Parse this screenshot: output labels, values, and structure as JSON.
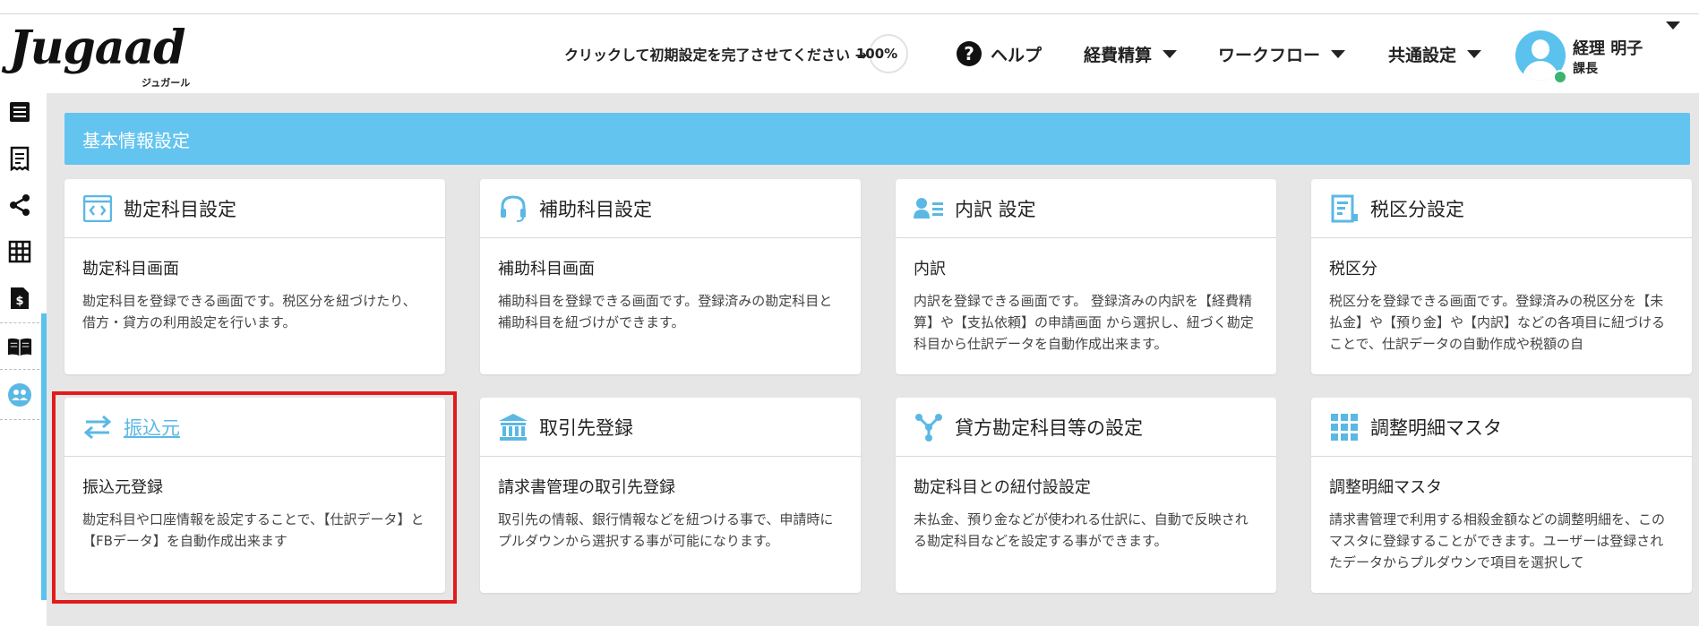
{
  "header": {
    "logo_text": "Jugaad",
    "logo_sub": "ジュガール",
    "setup_text": "クリックして初期設定を完了させてください →",
    "setup_progress": "100%",
    "help_label": "ヘルプ",
    "nav": [
      {
        "label": "経費精算"
      },
      {
        "label": "ワークフロー"
      },
      {
        "label": "共通設定"
      }
    ],
    "user": {
      "name": "経理 明子",
      "role": "課長"
    }
  },
  "sidebar": {
    "icons": [
      "list-icon",
      "receipt-icon",
      "share-icon",
      "grid-icon",
      "invoice-icon",
      "manual-book-icon",
      "support-icon"
    ]
  },
  "section": {
    "title": "基本情報設定"
  },
  "cards": [
    {
      "title": "勘定科目設定",
      "icon": "code-window-icon",
      "subtitle": "勘定科目画面",
      "desc": "勘定科目を登録できる画面です。税区分を紐づけたり、借方・貸方の利用設定を行います。"
    },
    {
      "title": "補助科目設定",
      "icon": "headset-icon",
      "subtitle": "補助科目画面",
      "desc": "補助科目を登録できる画面です。登録済みの勘定科目と補助科目を紐づけができます。"
    },
    {
      "title": "内訳 設定",
      "icon": "user-list-icon",
      "subtitle": "内訳",
      "desc": "内訳を登録できる画面です。 登録済みの内訳を【経費精算】や【支払依頼】の申請画面 から選択し、紐づく勘定科目から仕訳データを自動作成出来ます。"
    },
    {
      "title": "税区分設定",
      "icon": "tax-doc-icon",
      "subtitle": "税区分",
      "desc": "税区分を登録できる画面です。登録済みの税区分を【未払金】や【預り金】や【内訳】などの各項目に紐づけることで、仕訳データの自動作成や税額の自"
    },
    {
      "title": "振込元",
      "icon": "transfer-arrows-icon",
      "subtitle": "振込元登録",
      "desc": "勘定科目や口座情報を設定することで、【仕訳データ】と 【FBデータ】を自動作成出来ます"
    },
    {
      "title": "取引先登録",
      "icon": "bank-icon",
      "subtitle": "請求書管理の取引先登録",
      "desc": "取引先の情報、銀行情報などを紐つける事で、申請時にプルダウンから選択する事が可能になります。"
    },
    {
      "title": "貸方勘定科目等の設定",
      "icon": "network-icon",
      "subtitle": "勘定科目との紐付設設定",
      "desc": "未払金、預り金などが使われる仕訳に、自動で反映される勘定科目などを設定する事ができます。"
    },
    {
      "title": "調整明細マスタ",
      "icon": "grid-dots-icon",
      "subtitle": "調整明細マスタ",
      "desc": "請求書管理で利用する相殺金額などの調整明細を、このマスタに登録することができます。ユーザーは登録されたデータからプルダウンで項目を選択して"
    }
  ],
  "colors": {
    "accent": "#63c4f0",
    "highlight": "#e31b1b",
    "icon": "#5bb8e4"
  }
}
